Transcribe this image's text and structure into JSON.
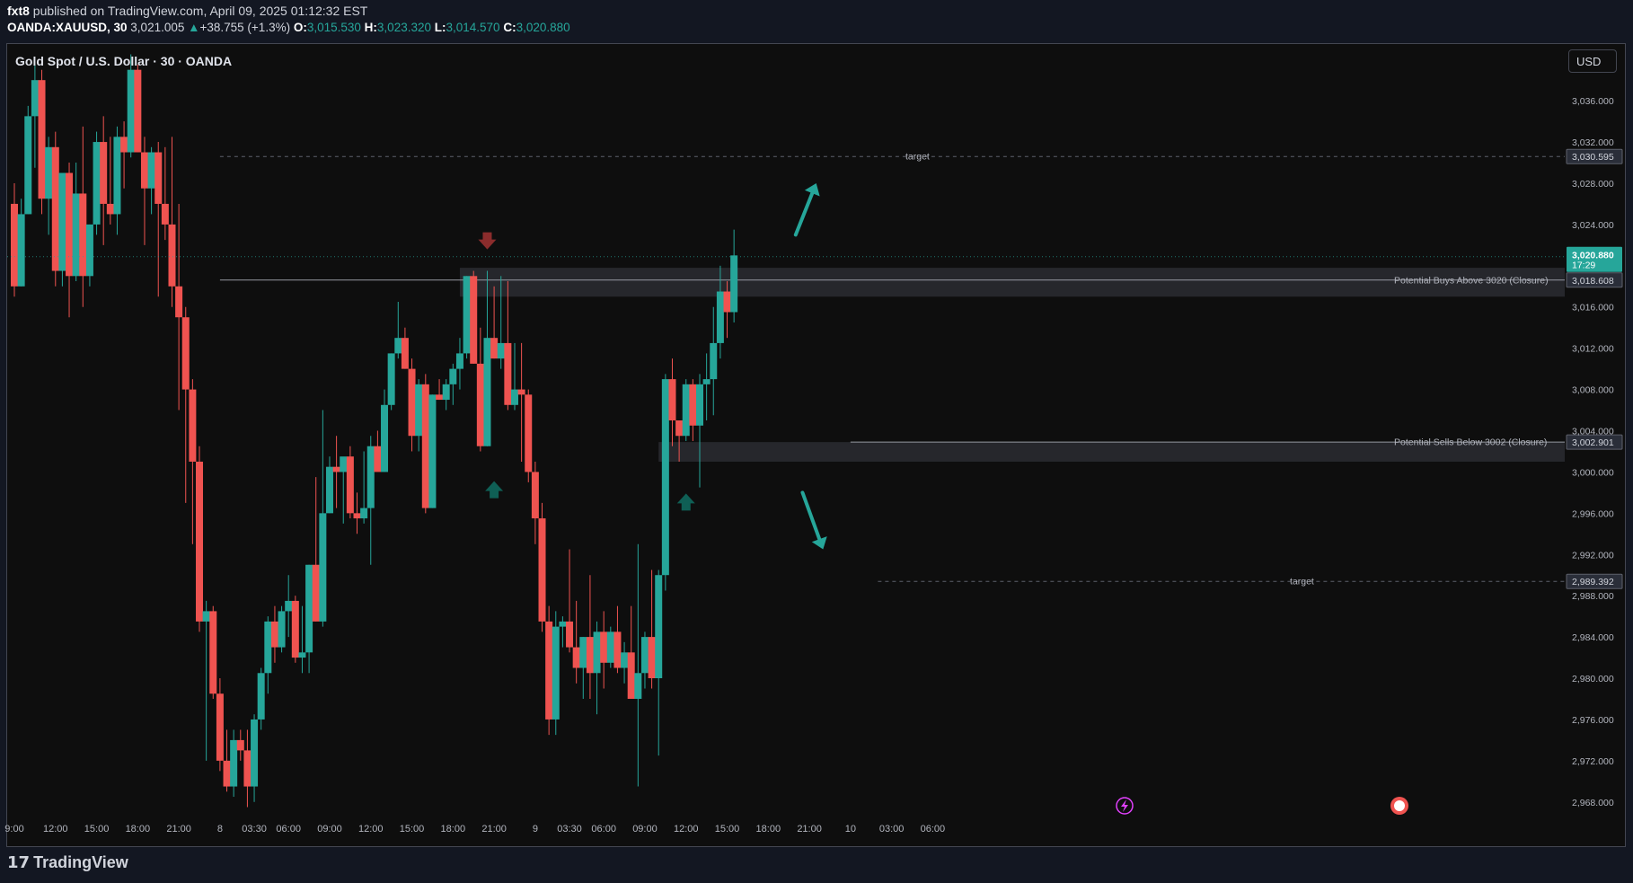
{
  "header": {
    "publisher": "fxt8",
    "published_text": "published on TradingView.com, April 09, 2025 01:12:32 EST",
    "symbol": "OANDA:XAUUSD, 30",
    "last": "3,021.005",
    "change": "+38.755 (+1.3%)",
    "open_label": "O:",
    "open": "3,015.530",
    "high_label": "H:",
    "high": "3,023.320",
    "low_label": "L:",
    "low": "3,014.570",
    "close_label": "C:",
    "close": "3,020.880"
  },
  "legend_title": "Gold Spot / U.S. Dollar · 30 · OANDA",
  "currency_button": "USD",
  "footer_brand": "TradingView",
  "colors": {
    "up": "#26a69a",
    "down": "#ef5350",
    "bg": "#0e0e0e",
    "axis_text": "#b2b5be",
    "arrow_down": "#8b2c2c",
    "arrow_up": "#0f5f55"
  },
  "chart_data": {
    "type": "candlestick",
    "y_ticks": [
      "3,036.000",
      "3,032.000",
      "3,028.000",
      "3,024.000",
      "3,016.000",
      "3,012.000",
      "3,008.000",
      "3,004.000",
      "3,000.000",
      "2,996.000",
      "2,992.000",
      "2,988.000",
      "2,984.000",
      "2,980.000",
      "2,976.000",
      "2,972.000",
      "2,968.000"
    ],
    "ylim": [
      2966.5,
      3041.5
    ],
    "x_ticks": [
      {
        "label": "9:00",
        "i": 0
      },
      {
        "label": "12:00",
        "i": 6
      },
      {
        "label": "15:00",
        "i": 12
      },
      {
        "label": "18:00",
        "i": 18
      },
      {
        "label": "21:00",
        "i": 24
      },
      {
        "label": "8",
        "i": 30
      },
      {
        "label": "03:30",
        "i": 35
      },
      {
        "label": "06:00",
        "i": 40
      },
      {
        "label": "09:00",
        "i": 46
      },
      {
        "label": "12:00",
        "i": 52
      },
      {
        "label": "15:00",
        "i": 58
      },
      {
        "label": "18:00",
        "i": 64
      },
      {
        "label": "21:00",
        "i": 70
      },
      {
        "label": "9",
        "i": 76
      },
      {
        "label": "03:30",
        "i": 81
      },
      {
        "label": "06:00",
        "i": 86
      },
      {
        "label": "09:00",
        "i": 92
      },
      {
        "label": "12:00",
        "i": 98
      },
      {
        "label": "15:00",
        "i": 104
      },
      {
        "label": "18:00",
        "i": 110
      },
      {
        "label": "21:00",
        "i": 116
      },
      {
        "label": "10",
        "i": 122
      },
      {
        "label": "03:00",
        "i": 128
      },
      {
        "label": "06:00",
        "i": 134
      }
    ],
    "candles": [
      [
        3026.0,
        3028.0,
        3017.0,
        3018.0
      ],
      [
        3018.0,
        3026.5,
        3018.0,
        3025.0
      ],
      [
        3025.0,
        3035.5,
        3025.0,
        3034.5
      ],
      [
        3034.5,
        3039.5,
        3029.5,
        3038.0
      ],
      [
        3038.0,
        3039.0,
        3025.0,
        3026.5
      ],
      [
        3026.5,
        3032.5,
        3023.0,
        3031.5
      ],
      [
        3031.5,
        3033.0,
        3018.0,
        3019.5
      ],
      [
        3019.5,
        3029.0,
        3018.0,
        3029.0
      ],
      [
        3029.0,
        3030.0,
        3015.0,
        3019.0
      ],
      [
        3019.0,
        3030.0,
        3018.5,
        3027.0
      ],
      [
        3027.0,
        3033.5,
        3016.0,
        3019.0
      ],
      [
        3019.0,
        3024.0,
        3018.0,
        3024.0
      ],
      [
        3024.0,
        3033.0,
        3023.0,
        3032.0
      ],
      [
        3032.0,
        3034.5,
        3022.0,
        3026.0
      ],
      [
        3026.0,
        3032.5,
        3024.0,
        3025.0
      ],
      [
        3025.0,
        3033.5,
        3023.0,
        3032.5
      ],
      [
        3032.5,
        3034.0,
        3027.5,
        3031.0
      ],
      [
        3031.0,
        3040.5,
        3030.5,
        3039.0
      ],
      [
        3039.0,
        3039.5,
        3031.0,
        3031.0
      ],
      [
        3031.0,
        3032.5,
        3022.0,
        3027.5
      ],
      [
        3027.5,
        3031.5,
        3025.0,
        3031.0
      ],
      [
        3031.0,
        3032.0,
        3017.0,
        3026.0
      ],
      [
        3026.0,
        3031.5,
        3022.5,
        3024.0
      ],
      [
        3024.0,
        3032.5,
        3016.0,
        3018.0
      ],
      [
        3018.0,
        3026.0,
        3006.0,
        3015.0
      ],
      [
        3015.0,
        3016.0,
        2997.0,
        3008.0
      ],
      [
        3008.0,
        3009.0,
        2993.0,
        3001.0
      ],
      [
        3001.0,
        3002.5,
        2984.5,
        2985.5
      ],
      [
        2985.5,
        2987.5,
        2972.0,
        2986.5
      ],
      [
        2986.5,
        2987.0,
        2978.0,
        2978.5
      ],
      [
        2978.5,
        2980.0,
        2971.0,
        2972.0
      ],
      [
        2972.0,
        2975.0,
        2969.0,
        2969.5
      ],
      [
        2969.5,
        2975.0,
        2968.5,
        2974.0
      ],
      [
        2974.0,
        2975.0,
        2972.0,
        2973.0
      ],
      [
        2973.0,
        2975.0,
        2967.5,
        2969.5
      ],
      [
        2969.5,
        2976.5,
        2968.0,
        2976.0
      ],
      [
        2976.0,
        2981.0,
        2975.0,
        2980.5
      ],
      [
        2980.5,
        2986.0,
        2978.5,
        2985.5
      ],
      [
        2985.5,
        2987.0,
        2981.5,
        2983.0
      ],
      [
        2983.0,
        2987.0,
        2982.5,
        2986.5
      ],
      [
        2986.5,
        2990.0,
        2984.0,
        2987.5
      ],
      [
        2987.5,
        2988.0,
        2981.5,
        2982.0
      ],
      [
        2982.0,
        2987.0,
        2980.5,
        2982.5
      ],
      [
        2982.5,
        2991.0,
        2980.5,
        2991.0
      ],
      [
        2991.0,
        2999.5,
        2985.5,
        2985.5
      ],
      [
        2985.5,
        3006.0,
        2985.0,
        2996.0
      ],
      [
        2996.0,
        3001.5,
        2996.0,
        3000.5
      ],
      [
        3000.5,
        3003.5,
        2996.5,
        3000.0
      ],
      [
        3000.0,
        3001.0,
        2995.0,
        3001.5
      ],
      [
        3001.5,
        3002.5,
        2995.5,
        2996.0
      ],
      [
        2996.0,
        2998.0,
        2994.0,
        2995.5
      ],
      [
        2995.5,
        3002.0,
        2995.0,
        2996.5
      ],
      [
        2996.5,
        3003.5,
        2991.0,
        3002.5
      ],
      [
        3002.5,
        3004.0,
        3002.0,
        3000.0
      ],
      [
        3000.0,
        3008.0,
        3000.0,
        3006.5
      ],
      [
        3006.5,
        3011.5,
        3006.0,
        3011.5
      ],
      [
        3011.5,
        3016.5,
        3011.0,
        3013.0
      ],
      [
        3013.0,
        3014.0,
        3010.0,
        3010.0
      ],
      [
        3010.0,
        3011.0,
        3002.0,
        3003.5
      ],
      [
        3003.5,
        3009.0,
        3002.0,
        3008.5
      ],
      [
        3008.5,
        3009.5,
        2996.0,
        2996.5
      ],
      [
        2996.5,
        3007.5,
        2996.5,
        3007.5
      ],
      [
        3007.5,
        3009.0,
        3007.0,
        3007.0
      ],
      [
        3007.0,
        3009.0,
        3006.0,
        3008.5
      ],
      [
        3008.5,
        3010.5,
        3006.5,
        3010.0
      ],
      [
        3010.0,
        3013.0,
        3008.0,
        3011.5
      ],
      [
        3011.5,
        3019.0,
        3011.0,
        3019.0
      ],
      [
        3019.0,
        3019.5,
        3010.5,
        3010.5
      ],
      [
        3010.5,
        3014.0,
        3002.0,
        3002.5
      ],
      [
        3002.5,
        3019.5,
        3002.5,
        3013.0
      ],
      [
        3013.0,
        3018.0,
        3011.0,
        3011.0
      ],
      [
        3011.0,
        3019.0,
        3010.0,
        3012.5
      ],
      [
        3012.5,
        3018.5,
        3006.0,
        3006.5
      ],
      [
        3006.5,
        3012.5,
        3006.0,
        3008.0
      ],
      [
        3008.0,
        3012.5,
        3001.0,
        3007.5
      ],
      [
        3007.5,
        3008.0,
        2999.0,
        3000.0
      ],
      [
        3000.0,
        3001.0,
        2993.0,
        2995.5
      ],
      [
        2995.5,
        2997.0,
        2984.5,
        2985.5
      ],
      [
        2985.5,
        2987.0,
        2974.5,
        2976.0
      ],
      [
        2976.0,
        2986.5,
        2974.5,
        2985.0
      ],
      [
        2985.0,
        2986.0,
        2983.0,
        2985.5
      ],
      [
        2985.5,
        2992.5,
        2982.5,
        2983.0
      ],
      [
        2983.0,
        2987.5,
        2979.5,
        2981.0
      ],
      [
        2981.0,
        2984.0,
        2978.0,
        2984.0
      ],
      [
        2984.0,
        2990.0,
        2978.0,
        2980.5
      ],
      [
        2980.5,
        2985.5,
        2976.5,
        2984.5
      ],
      [
        2984.5,
        2986.5,
        2979.0,
        2981.5
      ],
      [
        2981.5,
        2985.0,
        2981.0,
        2984.5
      ],
      [
        2984.5,
        2987.0,
        2980.5,
        2981.0
      ],
      [
        2981.0,
        2983.5,
        2979.5,
        2982.5
      ],
      [
        2982.5,
        2987.0,
        2979.0,
        2978.0
      ],
      [
        2978.0,
        2993.0,
        2969.5,
        2980.5
      ],
      [
        2980.5,
        2984.5,
        2979.0,
        2984.0
      ],
      [
        2984.0,
        2990.5,
        2979.0,
        2980.0
      ],
      [
        2980.0,
        2990.5,
        2972.5,
        2990.0
      ],
      [
        2990.0,
        3009.5,
        2988.5,
        3009.0
      ],
      [
        3009.0,
        3011.0,
        3002.5,
        3005.0
      ],
      [
        3005.0,
        3004.5,
        3001.0,
        3003.5
      ],
      [
        3003.5,
        3009.0,
        3003.0,
        3008.5
      ],
      [
        3008.5,
        3009.0,
        3003.0,
        3004.5
      ],
      [
        3004.5,
        3009.5,
        2998.5,
        3008.5
      ],
      [
        3008.5,
        3011.5,
        3005.0,
        3009.0
      ],
      [
        3009.0,
        3016.0,
        3005.5,
        3012.5
      ],
      [
        3012.5,
        3020.0,
        3011.0,
        3017.5
      ],
      [
        3017.5,
        3018.5,
        3013.0,
        3015.5
      ],
      [
        3015.5,
        3023.5,
        3014.5,
        3021.0
      ]
    ],
    "levels": [
      {
        "name": "target",
        "price": 3030.595,
        "label": "target",
        "axis_tag": "3,030.595"
      },
      {
        "name": "buys",
        "price": 3018.608,
        "label": "Potential Buys Above 3020 (Closure)",
        "axis_tag": "3,018.608"
      },
      {
        "name": "sells",
        "price": 3002.901,
        "label": "Potential Sells Below 3002 (Closure)",
        "axis_tag": "3,002.901"
      },
      {
        "name": "target-low",
        "price": 2989.392,
        "label": "target",
        "axis_tag": "2,989.392"
      }
    ],
    "current_price": {
      "price": 3020.88,
      "value": "3,020.880",
      "countdown": "17:29"
    },
    "zones": [
      {
        "name": "buy-zone",
        "from": 3017.0,
        "to": 3019.8,
        "i_start": 65,
        "i_end": 138
      },
      {
        "name": "sell-zone",
        "from": 3001.0,
        "to": 3002.9,
        "i_start": 94,
        "i_end": 138
      }
    ],
    "arrows": [
      {
        "name": "sell-arrow-marker",
        "i": 69,
        "price": 3022.2,
        "dir": "down",
        "color": "#8b2c2c"
      },
      {
        "name": "buy-arrow-marker-1",
        "i": 70,
        "price": 2998.5,
        "dir": "up",
        "color": "#0f5f55"
      },
      {
        "name": "buy-arrow-marker-2",
        "i": 98,
        "price": 2997.3,
        "dir": "up",
        "color": "#0f5f55"
      }
    ],
    "projection_arrows": [
      {
        "name": "projection-up-arrow",
        "from_i": 114,
        "from_price": 3023.0,
        "to_i": 117,
        "to_price": 3028.0
      },
      {
        "name": "projection-down-arrow",
        "from_i": 115,
        "from_price": 2998.0,
        "to_i": 118,
        "to_price": 2992.5
      }
    ]
  }
}
